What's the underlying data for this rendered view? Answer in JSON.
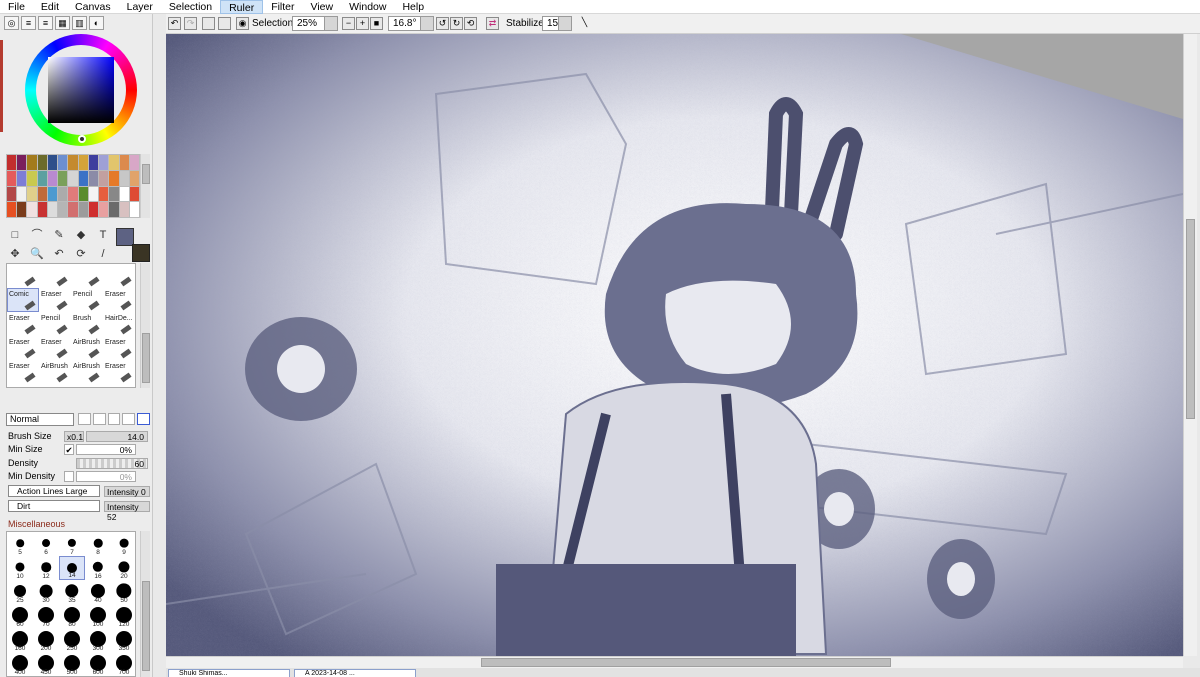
{
  "menu": [
    "File",
    "Edit",
    "Canvas",
    "Layer",
    "Selection",
    "Ruler",
    "Filter",
    "View",
    "Window",
    "Help"
  ],
  "menu_active": "Ruler",
  "toolbar": {
    "selection_label": "Selection",
    "zoom": "25%",
    "rotation": "16.8°",
    "stabilizer_label": "Stabilizer",
    "stabilizer_value": "15"
  },
  "colors": {
    "primary": "#5d6283",
    "secondary": "#3a3424",
    "swatches": [
      "#c22e2e",
      "#7a1f5c",
      "#a37b1c",
      "#6b6b2a",
      "#2e4f8a",
      "#6d8fcf",
      "#c48a2f",
      "#d4a33a",
      "#3e3e9e",
      "#9ea0d6",
      "#e2c56c",
      "#dc8a4d",
      "#d8a7c7",
      "#e45b5b",
      "#7d7dd6",
      "#c9c94e",
      "#5ca0a0",
      "#b98ad0",
      "#7aa05a",
      "#d4d4d4",
      "#3b72c6",
      "#8b8ba7",
      "#c2a0a0",
      "#e57a28",
      "#c7c7c7",
      "#e0a36a",
      "#b24848",
      "#f0f0f0",
      "#e0d08a",
      "#c06b3a",
      "#4b9ad0",
      "#ababab",
      "#e07b7b",
      "#5a8c2d",
      "#f4f4f4",
      "#e65e3e",
      "#888888",
      "#ffffff",
      "#de4b34",
      "#e65022",
      "#7b3b1a",
      "#f0e0e0",
      "#c83232",
      "#dcdcdc",
      "#b5b5b5",
      "#d26f6f",
      "#9c9c9c",
      "#cf2e2e",
      "#e8a0a0",
      "#6a6a6a",
      "#d8c0c0",
      "#ffffff"
    ]
  },
  "tools": [
    "□",
    "⌒",
    "✎",
    "◆",
    "T",
    "✥",
    "🔍",
    "↶",
    "⟳",
    "/"
  ],
  "brushes": [
    {
      "name": "",
      "sel": false
    },
    {
      "name": "",
      "sel": false
    },
    {
      "name": "",
      "sel": false
    },
    {
      "name": "",
      "sel": false
    },
    {
      "name": "Comic",
      "sel": true
    },
    {
      "name": "Eraser",
      "sel": false
    },
    {
      "name": "Pencil",
      "sel": false
    },
    {
      "name": "Eraser",
      "sel": false
    },
    {
      "name": "Eraser",
      "sel": false
    },
    {
      "name": "Pencil",
      "sel": false
    },
    {
      "name": "Brush",
      "sel": false
    },
    {
      "name": "HairDe...",
      "sel": false
    },
    {
      "name": "Eraser",
      "sel": false
    },
    {
      "name": "Eraser",
      "sel": false
    },
    {
      "name": "AirBrush",
      "sel": false
    },
    {
      "name": "Eraser",
      "sel": false
    },
    {
      "name": "Eraser",
      "sel": false
    },
    {
      "name": "AirBrush",
      "sel": false
    },
    {
      "name": "AirBrush",
      "sel": false
    },
    {
      "name": "Eraser",
      "sel": false
    }
  ],
  "brush_settings": {
    "blend_mode": "Normal",
    "brush_size_label": "Brush Size",
    "brush_size_mult": "x0.1",
    "brush_size_value": "14.0",
    "min_size_label": "Min Size",
    "min_size_value": "0%",
    "density_label": "Density",
    "density_value": "60",
    "min_density_label": "Min Density",
    "min_density_value": "0%",
    "texture1": "Action Lines Large",
    "texture1_intensity": "Intensity 0",
    "texture2": "Dirt",
    "texture2_intensity": "Intensity 52",
    "misc_label": "Miscellaneous"
  },
  "sizes": [
    "5",
    "6",
    "7",
    "8",
    "9",
    "10",
    "12",
    "14",
    "16",
    "20",
    "25",
    "30",
    "35",
    "40",
    "50",
    "60",
    "70",
    "80",
    "100",
    "120",
    "160",
    "200",
    "250",
    "300",
    "350",
    "400",
    "450",
    "500",
    "600",
    "700"
  ],
  "selected_size": "14",
  "tabs": [
    "Shuki Shimas...",
    "A 2023-14-08 ..."
  ]
}
